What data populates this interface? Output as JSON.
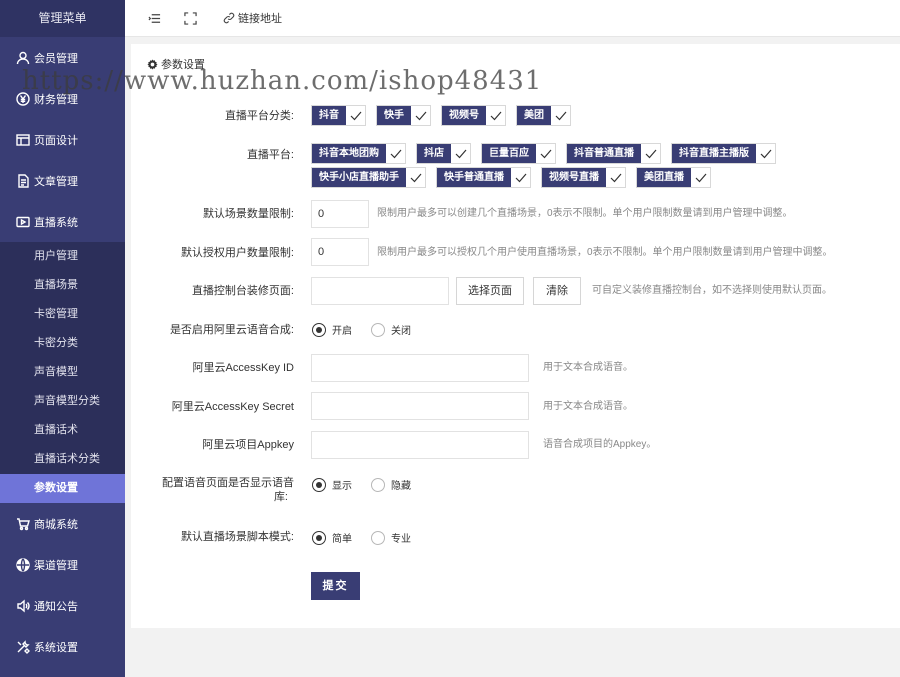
{
  "sidebar": {
    "title": "管理菜单",
    "items_top": [
      {
        "label": "会员管理",
        "icon": "user-icon"
      },
      {
        "label": "财务管理",
        "icon": "yen-icon"
      },
      {
        "label": "页面设计",
        "icon": "layout-icon"
      },
      {
        "label": "文章管理",
        "icon": "document-icon"
      },
      {
        "label": "直播系统",
        "icon": "play-icon"
      }
    ],
    "subitems": [
      "用户管理",
      "直播场景",
      "卡密管理",
      "卡密分类",
      "声音模型",
      "声音模型分类",
      "直播话术",
      "直播话术分类",
      "参数设置"
    ],
    "active_subitem": "参数设置",
    "items_bottom": [
      {
        "label": "商城系统",
        "icon": "cart-icon"
      },
      {
        "label": "渠道管理",
        "icon": "globe-icon"
      },
      {
        "label": "通知公告",
        "icon": "speaker-icon"
      },
      {
        "label": "系统设置",
        "icon": "tools-icon"
      }
    ]
  },
  "topbar": {
    "link_label": "链接地址"
  },
  "watermark": "https://www.huzhan.com/ishop48431",
  "panel": {
    "title": "参数设置",
    "category": {
      "label": "直播平台分类:",
      "tags": [
        "抖音",
        "快手",
        "视频号",
        "美团"
      ]
    },
    "platform": {
      "label": "直播平台:",
      "tags_row1": [
        "抖音本地团购",
        "抖店",
        "巨量百应",
        "抖音普通直播",
        "抖音直播主播版"
      ],
      "tags_row2": [
        "快手小店直播助手",
        "快手普通直播",
        "视频号直播",
        "美团直播"
      ]
    },
    "scene_limit": {
      "label": "默认场景数量限制:",
      "value": "0",
      "hint": "限制用户最多可以创建几个直播场景，0表示不限制。单个用户限制数量请到用户管理中调整。"
    },
    "auth_limit": {
      "label": "默认授权用户数量限制:",
      "value": "0",
      "hint": "限制用户最多可以授权几个用户使用直播场景，0表示不限制。单个用户限制数量请到用户管理中调整。"
    },
    "console_page": {
      "label": "直播控制台装修页面:",
      "value": "",
      "select_label": "选择页面",
      "clear_label": "清除",
      "hint": "可自定义装修直播控制台，如不选择则使用默认页面。"
    },
    "aliyun_tts": {
      "label": "是否启用阿里云语音合成:",
      "options": [
        "开启",
        "关闭"
      ],
      "selected": "开启"
    },
    "access_key_id": {
      "label": "阿里云AccessKey ID",
      "value": "",
      "hint": "用于文本合成语音。"
    },
    "access_key_secret": {
      "label": "阿里云AccessKey Secret",
      "value": "",
      "hint": "用于文本合成语音。"
    },
    "appkey": {
      "label": "阿里云项目Appkey",
      "value": "",
      "hint": "语音合成项目的Appkey。"
    },
    "voice_lib": {
      "label_line1": "配置语音页面是否显示语音",
      "label_line2": "库:",
      "options": [
        "显示",
        "隐藏"
      ],
      "selected": "显示"
    },
    "script_mode": {
      "label": "默认直播场景脚本模式:",
      "options": [
        "简单",
        "专业"
      ],
      "selected": "简单"
    },
    "submit_label": "提交"
  }
}
